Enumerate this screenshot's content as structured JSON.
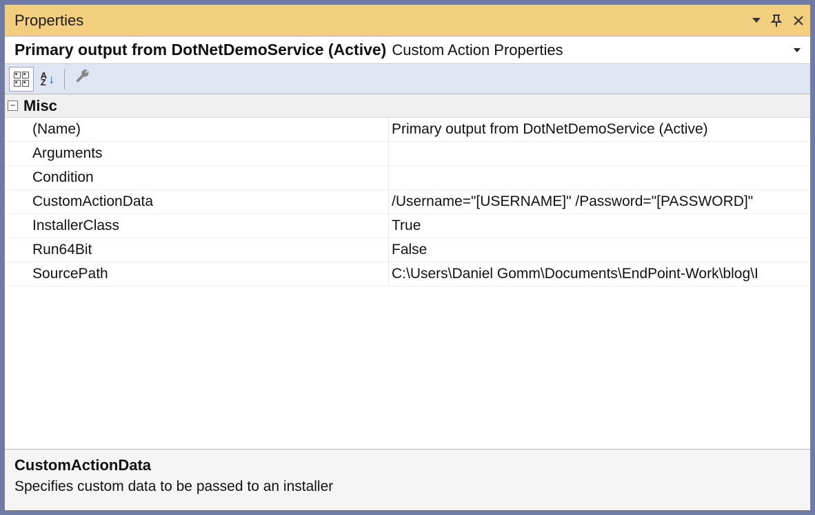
{
  "titlebar": {
    "title": "Properties"
  },
  "object_selector": {
    "name": "Primary output from DotNetDemoService (Active)",
    "type": "Custom Action Properties"
  },
  "category": {
    "name": "Misc",
    "collapsed": false
  },
  "props": [
    {
      "key": "name",
      "label": "(Name)",
      "value": "Primary output from DotNetDemoService (Active)",
      "selected": false,
      "readonly": true
    },
    {
      "key": "arguments",
      "label": "Arguments",
      "value": "",
      "selected": false,
      "readonly": false
    },
    {
      "key": "condition",
      "label": "Condition",
      "value": "",
      "selected": false,
      "readonly": false
    },
    {
      "key": "customdata",
      "label": "CustomActionData",
      "value": "/Username=\"[USERNAME]\" /Password=\"[PASSWORD]\"",
      "selected": true,
      "readonly": false
    },
    {
      "key": "installer",
      "label": "InstallerClass",
      "value": "True",
      "selected": false,
      "readonly": false
    },
    {
      "key": "run64",
      "label": "Run64Bit",
      "value": "False",
      "selected": false,
      "readonly": false
    },
    {
      "key": "srcpath",
      "label": "SourcePath",
      "value": "C:\\Users\\Daniel Gomm\\Documents\\EndPoint-Work\\blog\\I",
      "selected": false,
      "readonly": true
    }
  ],
  "description": {
    "title": "CustomActionData",
    "text": "Specifies custom data to be passed to an installer"
  }
}
